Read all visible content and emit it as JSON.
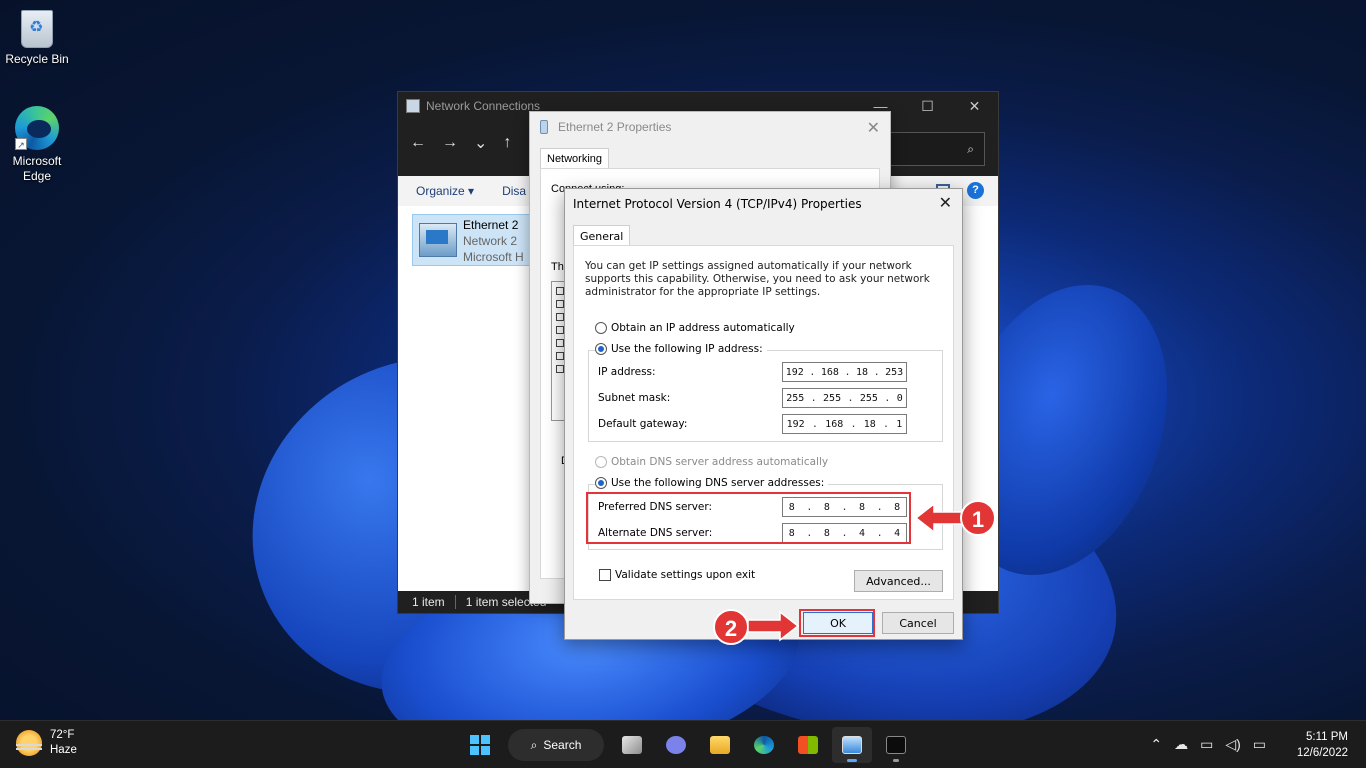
{
  "desktop": {
    "icons": [
      {
        "label": "Recycle Bin",
        "icon": "recycle-bin-icon"
      },
      {
        "label_line1": "Microsoft",
        "label_line2": "Edge",
        "icon": "edge-icon"
      }
    ]
  },
  "network_connections": {
    "title": "Network Connections",
    "toolbar": {
      "back": "←",
      "forward": "→",
      "recent": "⌄",
      "up": "↑",
      "search_icon": "⌕"
    },
    "cmdbar": {
      "organize": "Organize",
      "organize_arrow": "▾",
      "disable_partial": "Disa",
      "help": "?"
    },
    "item": {
      "name": "Ethernet 2",
      "network": "Network 2",
      "adapter_partial": "Microsoft H"
    },
    "status": {
      "count": "1 item",
      "selected": "1 item selected"
    }
  },
  "ethernet_properties": {
    "title": "Ethernet 2 Properties",
    "tab": "Networking",
    "connect_using_partial": "Connect using:",
    "list_label_partial": "Th",
    "desc_label_partial": "D"
  },
  "ipv4_dialog": {
    "title": "Internet Protocol Version 4 (TCP/IPv4) Properties",
    "tab": "General",
    "intro": "You can get IP settings assigned automatically if your network supports this capability. Otherwise, you need to ask your network administrator for the appropriate IP settings.",
    "ip_auto": "Obtain an IP address automatically",
    "ip_manual": "Use the following IP address:",
    "fields": {
      "ip_address": {
        "label": "IP address:",
        "octets": [
          "192",
          "168",
          "18",
          "253"
        ]
      },
      "subnet_mask": {
        "label": "Subnet mask:",
        "octets": [
          "255",
          "255",
          "255",
          "0"
        ]
      },
      "default_gateway": {
        "label": "Default gateway:",
        "octets": [
          "192",
          "168",
          "18",
          "1"
        ]
      },
      "preferred_dns": {
        "label": "Preferred DNS server:",
        "octets": [
          "8",
          "8",
          "8",
          "8"
        ]
      },
      "alternate_dns": {
        "label": "Alternate DNS server:",
        "octets": [
          "8",
          "8",
          "4",
          "4"
        ]
      }
    },
    "dns_auto": "Obtain DNS server address automatically",
    "dns_manual": "Use the following DNS server addresses:",
    "validate": "Validate settings upon exit",
    "advanced_button": "Advanced...",
    "ok_button": "OK",
    "cancel_button": "Cancel"
  },
  "callouts": {
    "step1": "1",
    "step2": "2",
    "color": "#e23636"
  },
  "taskbar": {
    "weather": {
      "temp": "72°F",
      "condition": "Haze"
    },
    "search_label": "Search",
    "clock": {
      "time": "5:11 PM",
      "date": "12/6/2022"
    },
    "tray": {
      "chevron": "⌃",
      "cloud": "☁",
      "volume": "🔊"
    }
  }
}
